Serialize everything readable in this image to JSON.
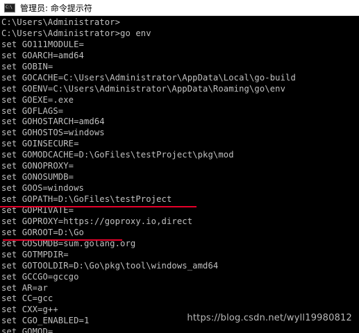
{
  "window": {
    "title": "管理员: 命令提示符",
    "icon": "C:\\",
    "icon_name": "cmd-icon"
  },
  "console": {
    "lines": [
      "C:\\Users\\Administrator>",
      "C:\\Users\\Administrator>go env",
      "set GO111MODULE=",
      "set GOARCH=amd64",
      "set GOBIN=",
      "set GOCACHE=C:\\Users\\Administrator\\AppData\\Local\\go-build",
      "set GOENV=C:\\Users\\Administrator\\AppData\\Roaming\\go\\env",
      "set GOEXE=.exe",
      "set GOFLAGS=",
      "set GOHOSTARCH=amd64",
      "set GOHOSTOS=windows",
      "set GOINSECURE=",
      "set GOMODCACHE=D:\\GoFiles\\testProject\\pkg\\mod",
      "set GONOPROXY=",
      "set GONOSUMDB=",
      "set GOOS=windows",
      "set GOPATH=D:\\GoFiles\\testProject",
      "set GOPRIVATE=",
      "set GOPROXY=https://goproxy.io,direct",
      "set GOROOT=D:\\Go",
      "set GOSUMDB=sum.golang.org",
      "set GOTMPDIR=",
      "set GOTOOLDIR=D:\\Go\\pkg\\tool\\windows_amd64",
      "set GCCGO=gccgo",
      "set AR=ar",
      "set CC=gcc",
      "set CXX=g++",
      "set CGO_ENABLED=1",
      "set GOMOD="
    ]
  },
  "watermark": "https://blog.csdn.net/wyll19980812",
  "colors": {
    "background": "#000000",
    "text": "#c0c0c0",
    "annotation": "#e8002a"
  }
}
